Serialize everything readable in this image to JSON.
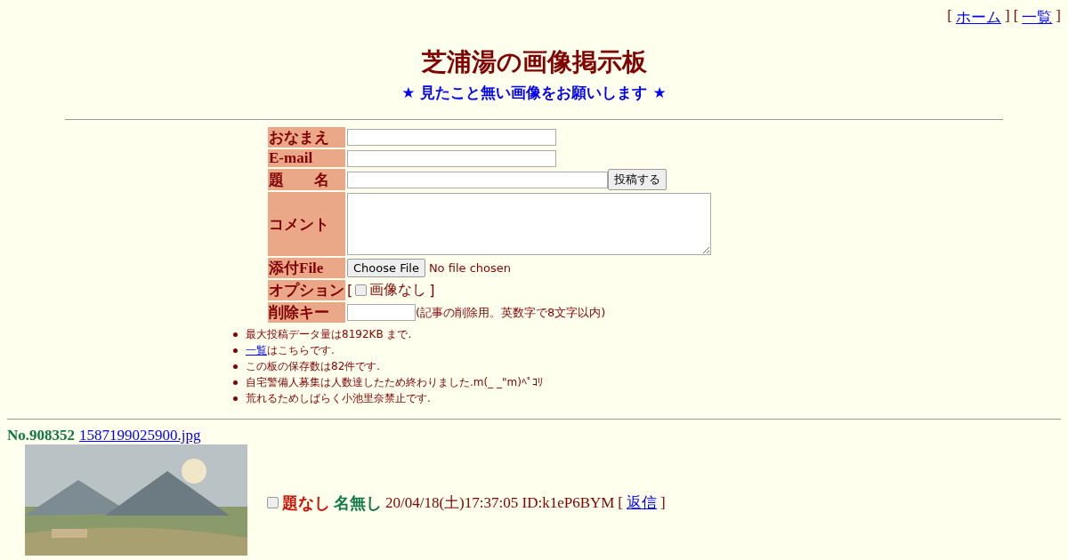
{
  "nav": [
    {
      "open": "[",
      "label": "ホーム",
      "close": "]"
    },
    {
      "open": "[",
      "label": "一覧",
      "close": "]"
    }
  ],
  "title": "芝浦湯の画像掲示板",
  "subtitle": "★ 見たこと無い画像をお願いします ★",
  "form": [
    {
      "kind": "text",
      "label": "おなまえ"
    },
    {
      "kind": "text",
      "label": "E-mail"
    },
    {
      "kind": "submit",
      "label": "題　　名",
      "button": "投稿する"
    },
    {
      "kind": "textarea",
      "label": "コメント"
    },
    {
      "kind": "file",
      "label": "添付File",
      "button": "Choose File",
      "status": "No file chosen"
    },
    {
      "kind": "option",
      "label": "オプション",
      "open": "[",
      "option": "画像なし",
      "checked": false,
      "close": "]"
    },
    {
      "kind": "key",
      "label": "削除キー",
      "hint": "(記事の削除用。英数字で8文字以内)"
    }
  ],
  "notes": [
    {
      "text": "最大投稿データ量は8192KB まで."
    },
    {
      "link": "一覧",
      "text": "はこちらです."
    },
    {
      "text": "この板の保存数は82件です."
    },
    {
      "text": "自宅警備人募集は人数達したため終わりました.m(_ _\"m)ﾍﾟｺﾘ"
    },
    {
      "text": "荒れるためしばらく小池里奈禁止です."
    }
  ],
  "posts": [
    {
      "number": "No.908352",
      "file": "1587199025900.jpg",
      "checked": false,
      "subject": "題なし",
      "name": "名無し",
      "date": "20/04/18(土)17:37:05 ID:k1eP6BYM",
      "open": "[",
      "reply": "返信",
      "close": "]"
    }
  ]
}
